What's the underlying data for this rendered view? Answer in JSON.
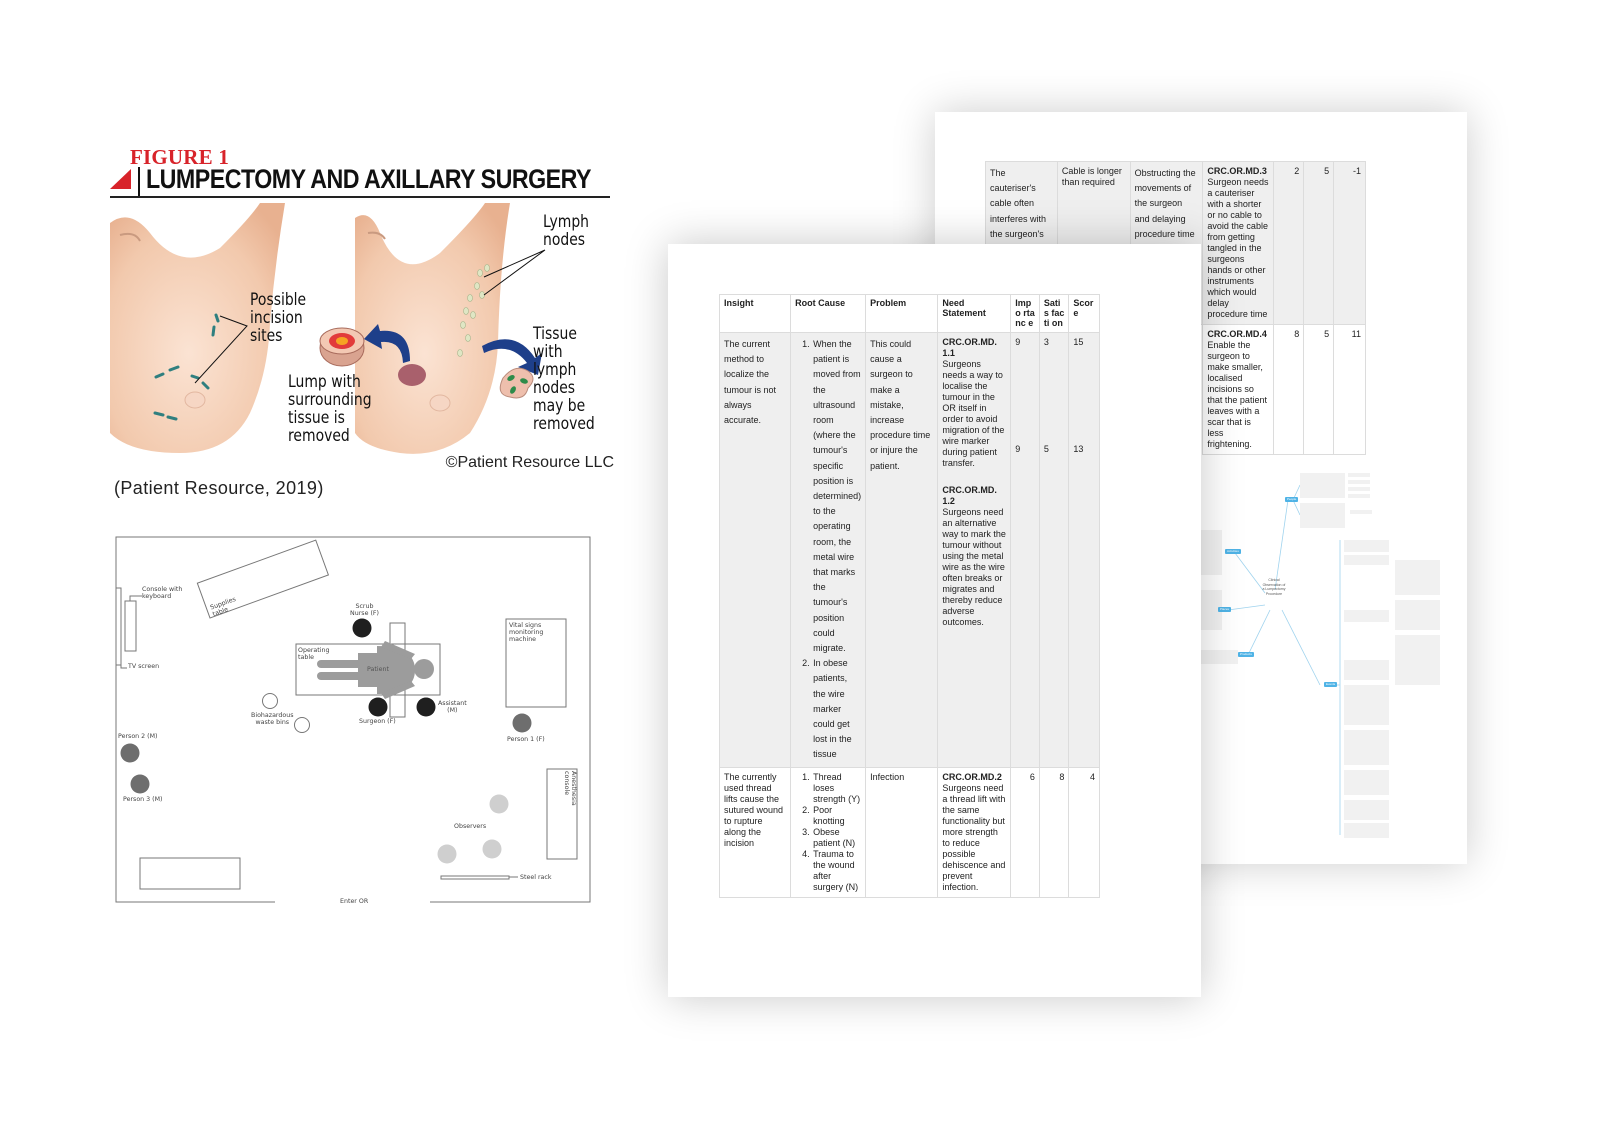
{
  "figure1": {
    "kicker": "FIGURE 1",
    "title": "LUMPECTOMY AND AXILLARY SURGERY",
    "labels": {
      "possible_incision_sites": [
        "Possible",
        "incision",
        "sites"
      ],
      "lymph_nodes": [
        "Lymph",
        "nodes"
      ],
      "lump_removed": [
        "Lump with",
        "surrounding",
        "tissue is",
        "removed"
      ],
      "tissue_removed": [
        "Tissue",
        "with",
        "lymph",
        "nodes",
        "may be",
        "removed"
      ]
    },
    "copyright": "©Patient Resource LLC",
    "citation": "(Patient Resource, 2019)",
    "colors": {
      "accent": "#d8232a",
      "arrow": "#1e3f8a",
      "incision": "#2f7f7f",
      "skin": "#f3cbb0"
    }
  },
  "floor_plan": {
    "labels": {
      "console": [
        "Console with",
        "keyboard"
      ],
      "tv_screen": "TV screen",
      "supplies_table": [
        "Supplies",
        "table"
      ],
      "scrub_nurse": [
        "Scrub",
        "Nurse (F)"
      ],
      "operating_table": [
        "Operating",
        "table"
      ],
      "patient": "Patient",
      "vital_signs": [
        "Vital signs",
        "monitoring",
        "machine"
      ],
      "surgeon": "Surgeon (F)",
      "assistant": [
        "Assistant",
        "(M)"
      ],
      "biohazard_bins": [
        "Biohazardous",
        "waste bins"
      ],
      "person1": "Person 1 (F)",
      "person2": "Person 2 (M)",
      "person3": "Person 3 (M)",
      "anesthesia_console": [
        "Anesthesia",
        "console"
      ],
      "observers": "Observers",
      "steel_rack": "Steel rack",
      "enter_or": "Enter OR"
    }
  },
  "front_table": {
    "headers": [
      "Insight",
      "Root Cause",
      "Problem",
      "Need Statement",
      "Impo rtanc e",
      "Satis facti on",
      "Scor e"
    ],
    "rows": [
      {
        "insight": "The current method to localize the tumour is not always accurate.",
        "root_causes": [
          "When the patient is moved from the ultrasound room (where the tumour's specific position is determined) to the operating room, the metal wire that marks the tumour's position could migrate.",
          "In obese patients, the wire marker could get lost in the tissue"
        ],
        "problem": "This could cause a surgeon to make a mistake, increase procedure time or injure the patient.",
        "needs": [
          {
            "id": "CRC.OR.MD. 1.1",
            "text": "Surgeons needs a way to localise the tumour in the OR itself in order to avoid migration of the wire marker during patient transfer.",
            "importance": "9",
            "satisfaction": "3",
            "score": "15"
          },
          {
            "id": "CRC.OR.MD. 1.2",
            "text": "Surgeons need an alternative way to mark the tumour without using the metal wire as the wire often breaks or migrates and thereby reduce adverse outcomes.",
            "importance": "9",
            "satisfaction": "5",
            "score": "13"
          }
        ]
      },
      {
        "insight": "The currently used thread lifts cause the sutured wound to rupture along the incision",
        "root_causes": [
          "Thread loses strength (Y)",
          "Poor knotting",
          "Obese patient (N)",
          "Trauma to the wound after surgery (N)"
        ],
        "problem": "Infection",
        "needs": [
          {
            "id": "CRC.OR.MD.2",
            "text": "Surgeons need a thread lift with the same functionality but more strength to reduce possible dehiscence and prevent infection.",
            "importance": "6",
            "satisfaction": "8",
            "score": "4"
          }
        ]
      }
    ]
  },
  "back_table": {
    "rows": [
      {
        "insight": "The cauteriser's cable often interferes with the surgeon's hands and",
        "root_cause": "Cable is longer than required",
        "problem": "Obstructing the movements of the surgeon and delaying procedure time",
        "need_id": "CRC.OR.MD.3",
        "need_text": "Surgeon needs a cauteriser with a shorter or no cable to avoid the cable from getting tangled in the surgeons hands or other instruments which would delay procedure time",
        "importance": "2",
        "satisfaction": "5",
        "score": "-1"
      },
      {
        "need_id": "CRC.OR.MD.4",
        "need_text": "Enable the surgeon to make smaller, localised incisions so that the patient leaves with a scar that is less frightening.",
        "importance": "8",
        "satisfaction": "5",
        "score": "11"
      }
    ]
  },
  "mindmap": {
    "center": [
      "Clinical",
      "Observation of",
      "a Lumpectomy",
      "Procedure"
    ],
    "branches": [
      "People",
      "Activities",
      "Places",
      "Products",
      "Events"
    ],
    "colors": {
      "node": "#4fb3e6",
      "line": "#9fd3ee"
    }
  }
}
